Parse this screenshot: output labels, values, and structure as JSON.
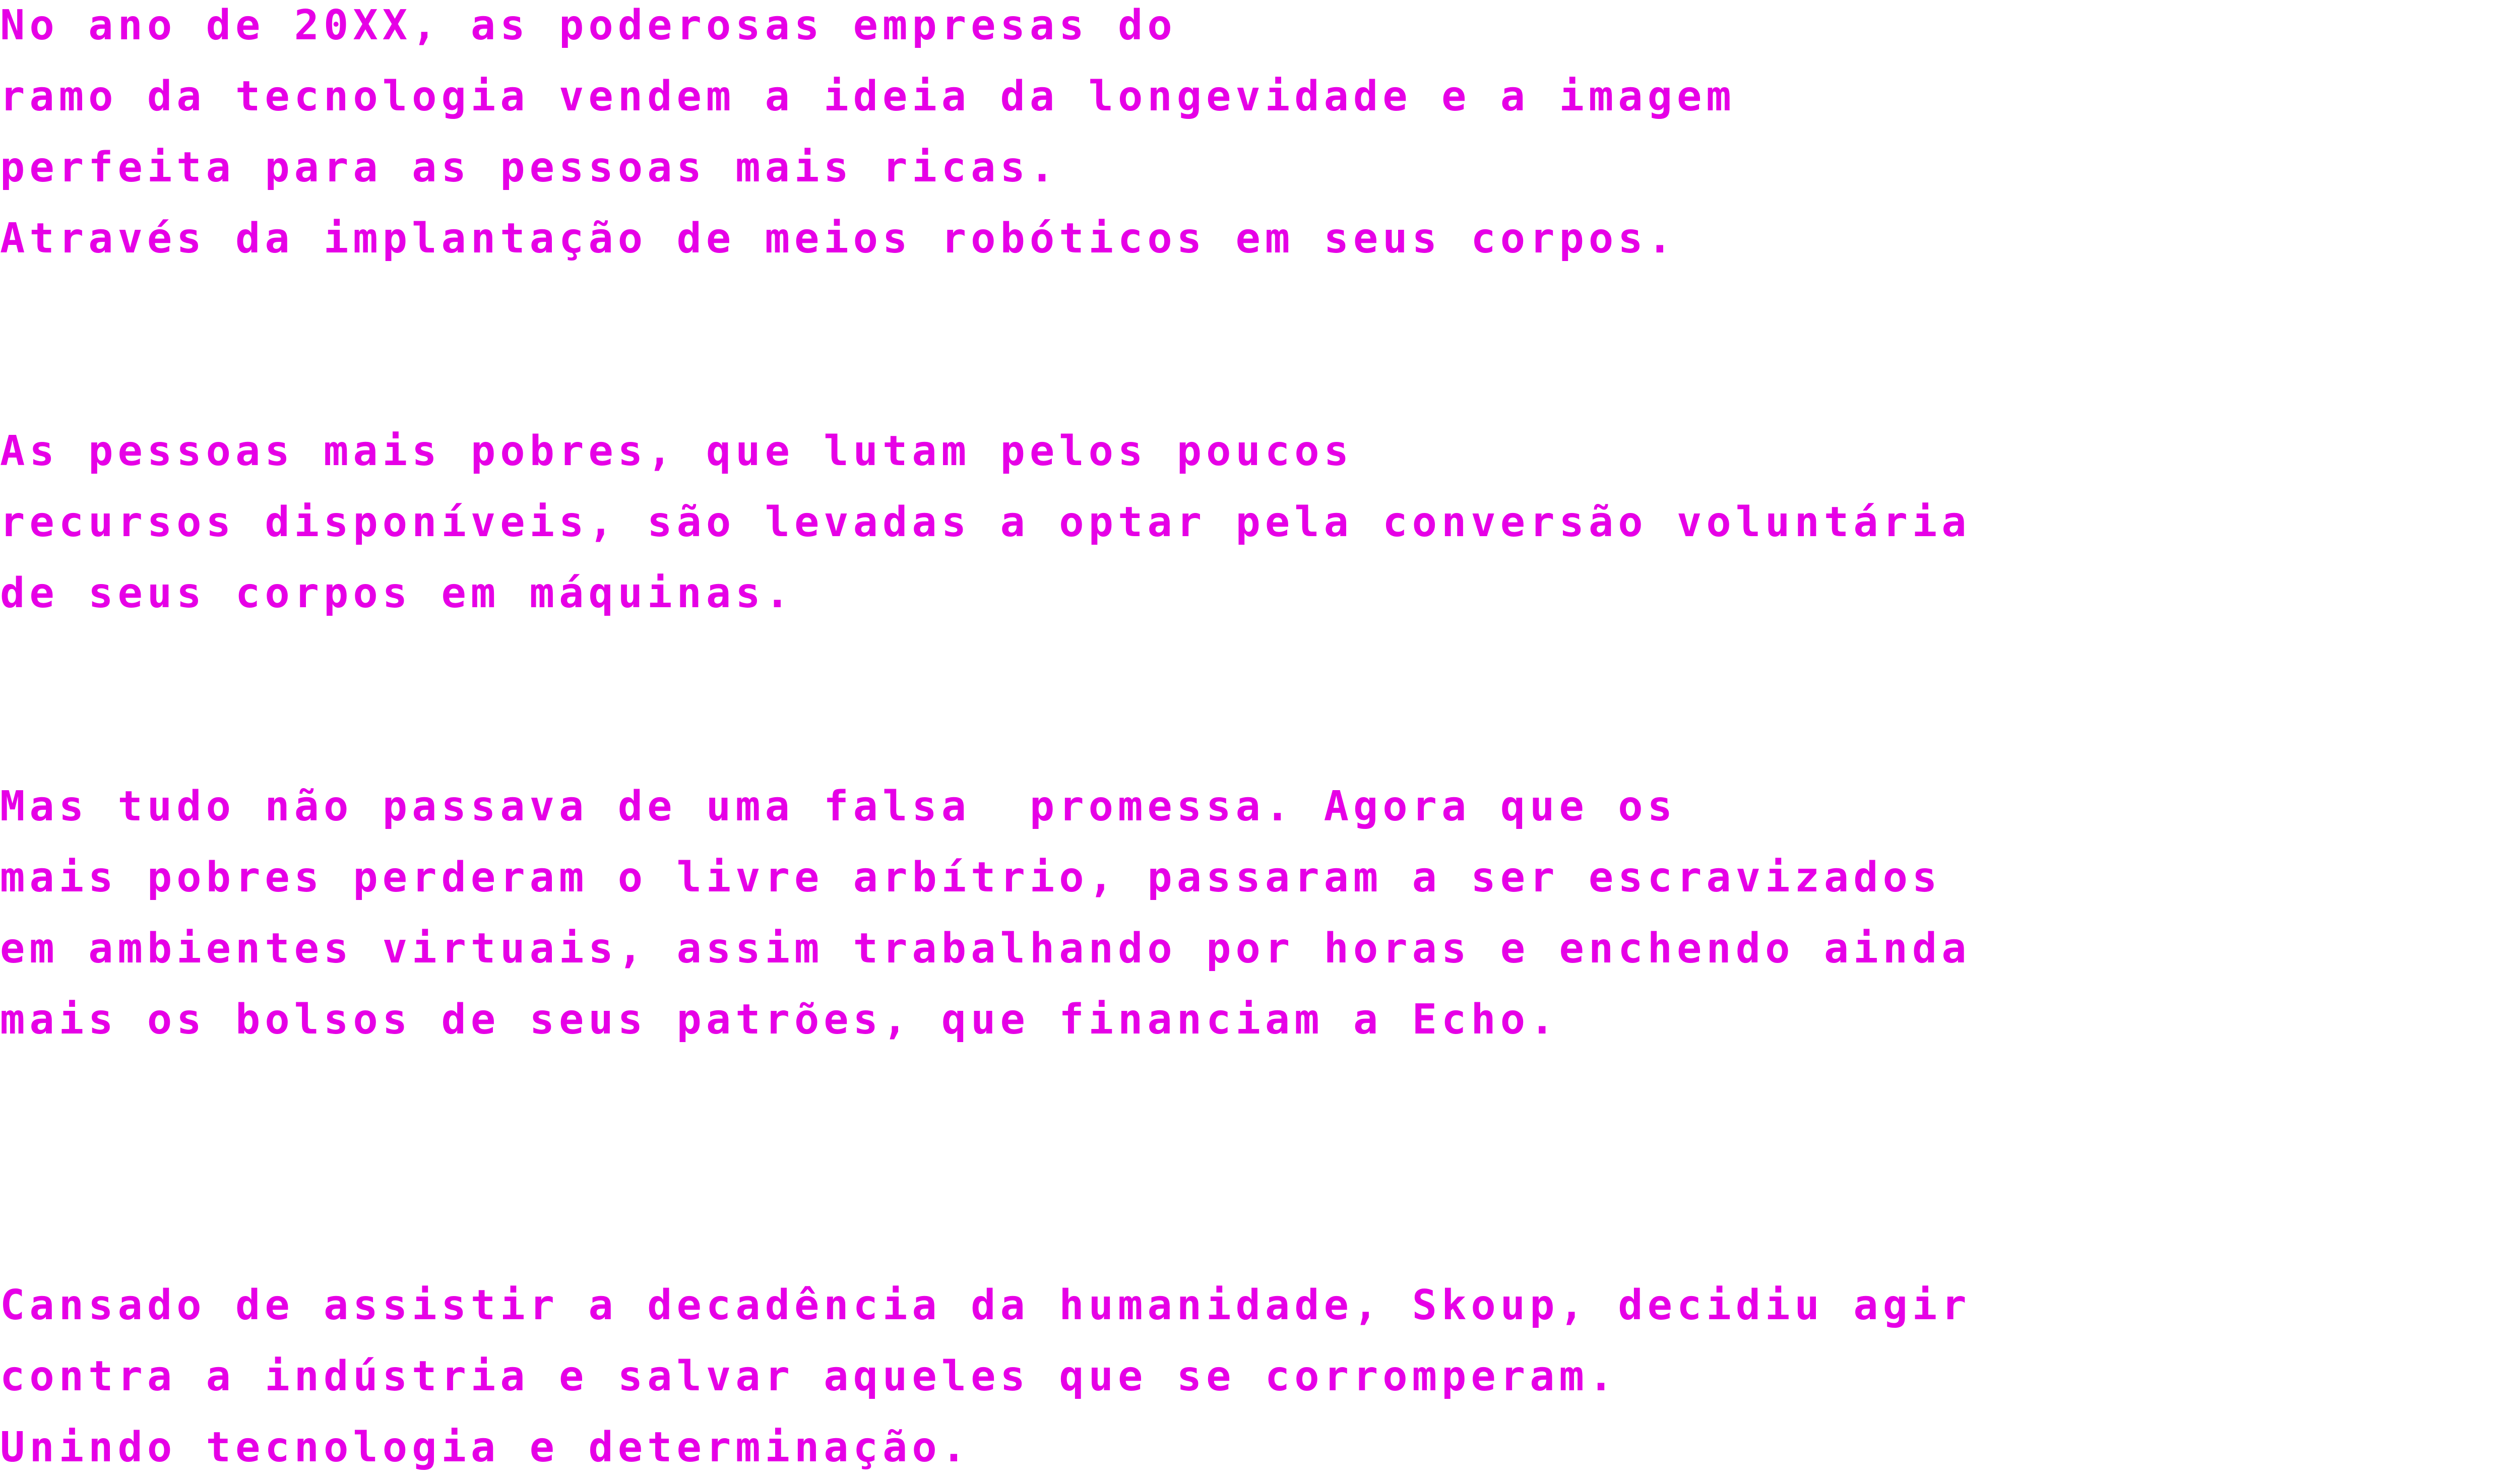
{
  "theme": {
    "text_color": "#e600e6",
    "background": "#ffffff"
  },
  "story": {
    "paragraphs": [
      {
        "lines": [
          "No ano de 20XX, as poderosas empresas do",
          "ramo da tecnologia vendem a ideia da longevidade e a imagem",
          "perfeita para as pessoas mais ricas.",
          "Através da implantação de meios robóticos em seus corpos."
        ]
      },
      {
        "lines": [
          "As pessoas mais pobres, que lutam pelos poucos",
          "recursos disponíveis, são levadas a optar pela conversão voluntária",
          "de seus corpos em máquinas."
        ]
      },
      {
        "lines": [
          "Mas tudo não passava de uma falsa  promessa. Agora que os",
          "mais pobres perderam o livre arbítrio, passaram a ser escravizados",
          "em ambientes virtuais, assim trabalhando por horas e enchendo ainda",
          "mais os bolsos de seus patrões, que financiam a Echo."
        ]
      },
      {
        "lines": [
          "Cansado de assistir a decadência da humanidade, Skoup, decidiu agir",
          "contra a indústria e salvar aqueles que se corromperam.",
          "Unindo tecnologia e determinação."
        ]
      }
    ]
  }
}
